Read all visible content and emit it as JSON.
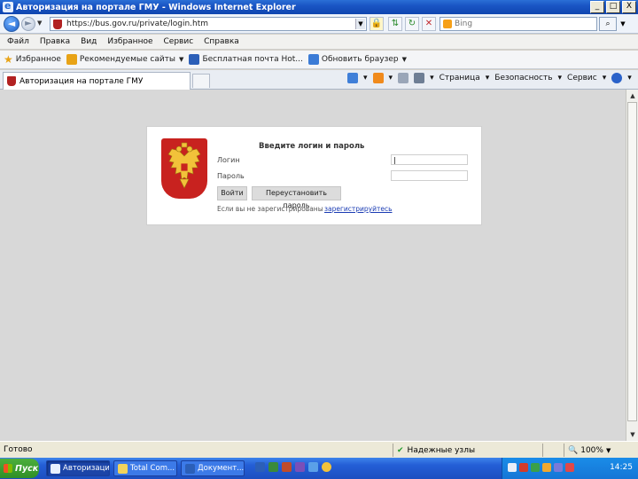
{
  "window": {
    "title": "Авторизация на портале ГМУ - Windows Internet Explorer",
    "buttons": {
      "minimize": "_",
      "maximize": "□",
      "close": "X"
    }
  },
  "addressbar": {
    "url": "https://bus.gov.ru/private/login.htm",
    "search_placeholder": "Bing",
    "search_button": "⌕"
  },
  "menu": {
    "items": [
      "Файл",
      "Правка",
      "Вид",
      "Избранное",
      "Сервис",
      "Справка"
    ]
  },
  "favorites": {
    "label": "Избранное",
    "items": [
      {
        "label": "Рекомендуемые сайты",
        "icon": "suggested-sites-icon",
        "color": "#e8a317"
      },
      {
        "label": "Бесплатная почта Hot...",
        "icon": "hotmail-icon",
        "color": "#2c5fb8"
      },
      {
        "label": "Обновить браузер",
        "icon": "ie-update-icon",
        "color": "#3b7bd6"
      }
    ]
  },
  "tabs": {
    "active": "Авторизация на портале ГМУ"
  },
  "commandbar": {
    "page": "Страница",
    "safety": "Безопасность",
    "tools": "Сервис"
  },
  "login": {
    "title": "Введите логин и пароль",
    "login_label": "Логин",
    "password_label": "Пароль",
    "login_value": "|",
    "password_value": "",
    "submit": "Войти",
    "reset": "Переустановить пароль",
    "register_prompt": "Если вы не зарегистрированы",
    "register_link": "зарегистрируйтесь"
  },
  "status": {
    "left": "Готово",
    "zone": "Надежные узлы",
    "zoom": "100%"
  },
  "taskbar": {
    "start": "Пуск",
    "windows": [
      {
        "label": "Авторизация...",
        "active": true
      },
      {
        "label": "Total Com...",
        "active": false
      },
      {
        "label": "Документ...",
        "active": false
      }
    ],
    "clock": "14:25"
  },
  "colors": {
    "emblem_red": "#c8221f",
    "link_blue": "#1a3bb3",
    "title_blue": "#1a55c4"
  }
}
